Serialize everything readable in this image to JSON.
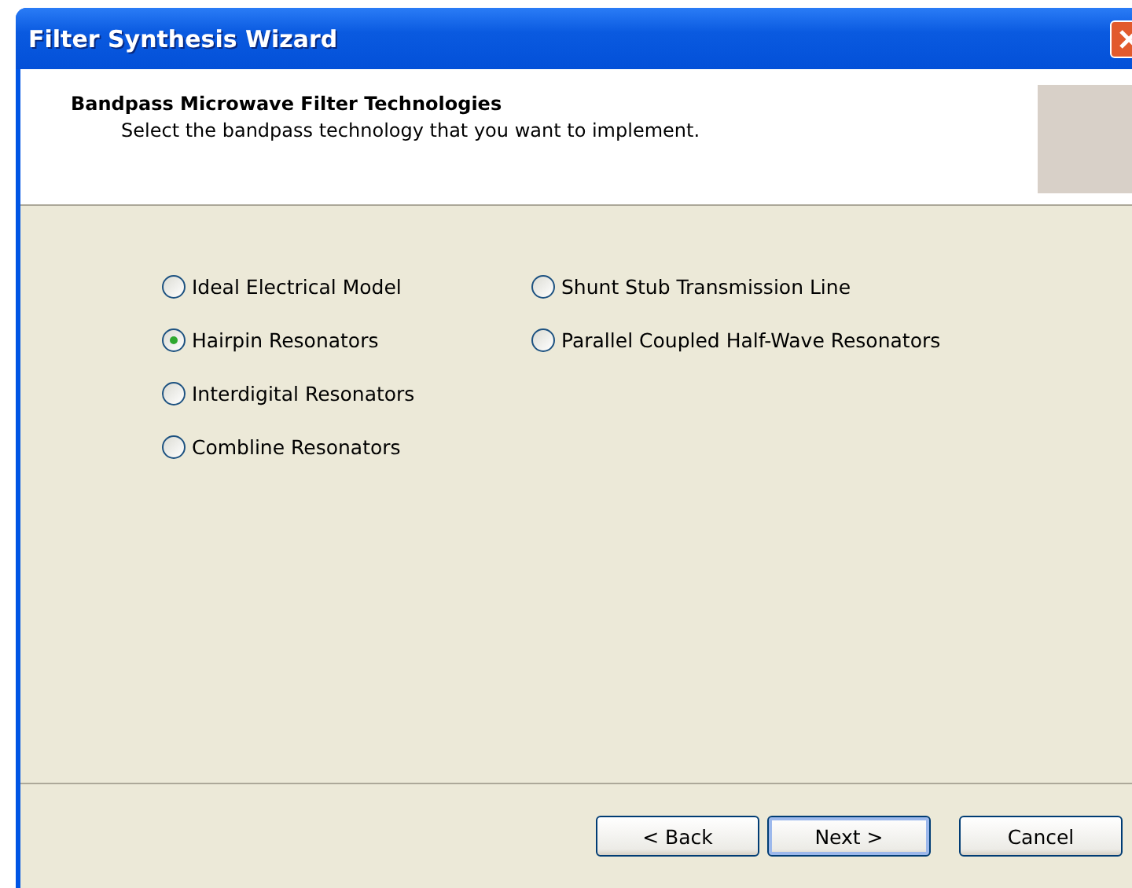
{
  "window": {
    "title": "Filter Synthesis Wizard"
  },
  "header": {
    "title": "Bandpass Microwave Filter Technologies",
    "subtitle": "Select the bandpass technology that you want to implement."
  },
  "options": [
    [
      {
        "label": "Ideal Electrical Model",
        "selected": false
      },
      {
        "label": "Hairpin Resonators",
        "selected": true
      },
      {
        "label": "Interdigital Resonators",
        "selected": false
      },
      {
        "label": "Combline Resonators",
        "selected": false
      }
    ],
    [
      {
        "label": "Shunt Stub Transmission Line",
        "selected": false
      },
      {
        "label": "Parallel Coupled Half-Wave Resonators",
        "selected": false
      }
    ]
  ],
  "buttons": [
    {
      "label": "< Back",
      "default": false
    },
    {
      "label": "Next >",
      "default": true
    },
    {
      "label": "Cancel",
      "default": false
    }
  ]
}
